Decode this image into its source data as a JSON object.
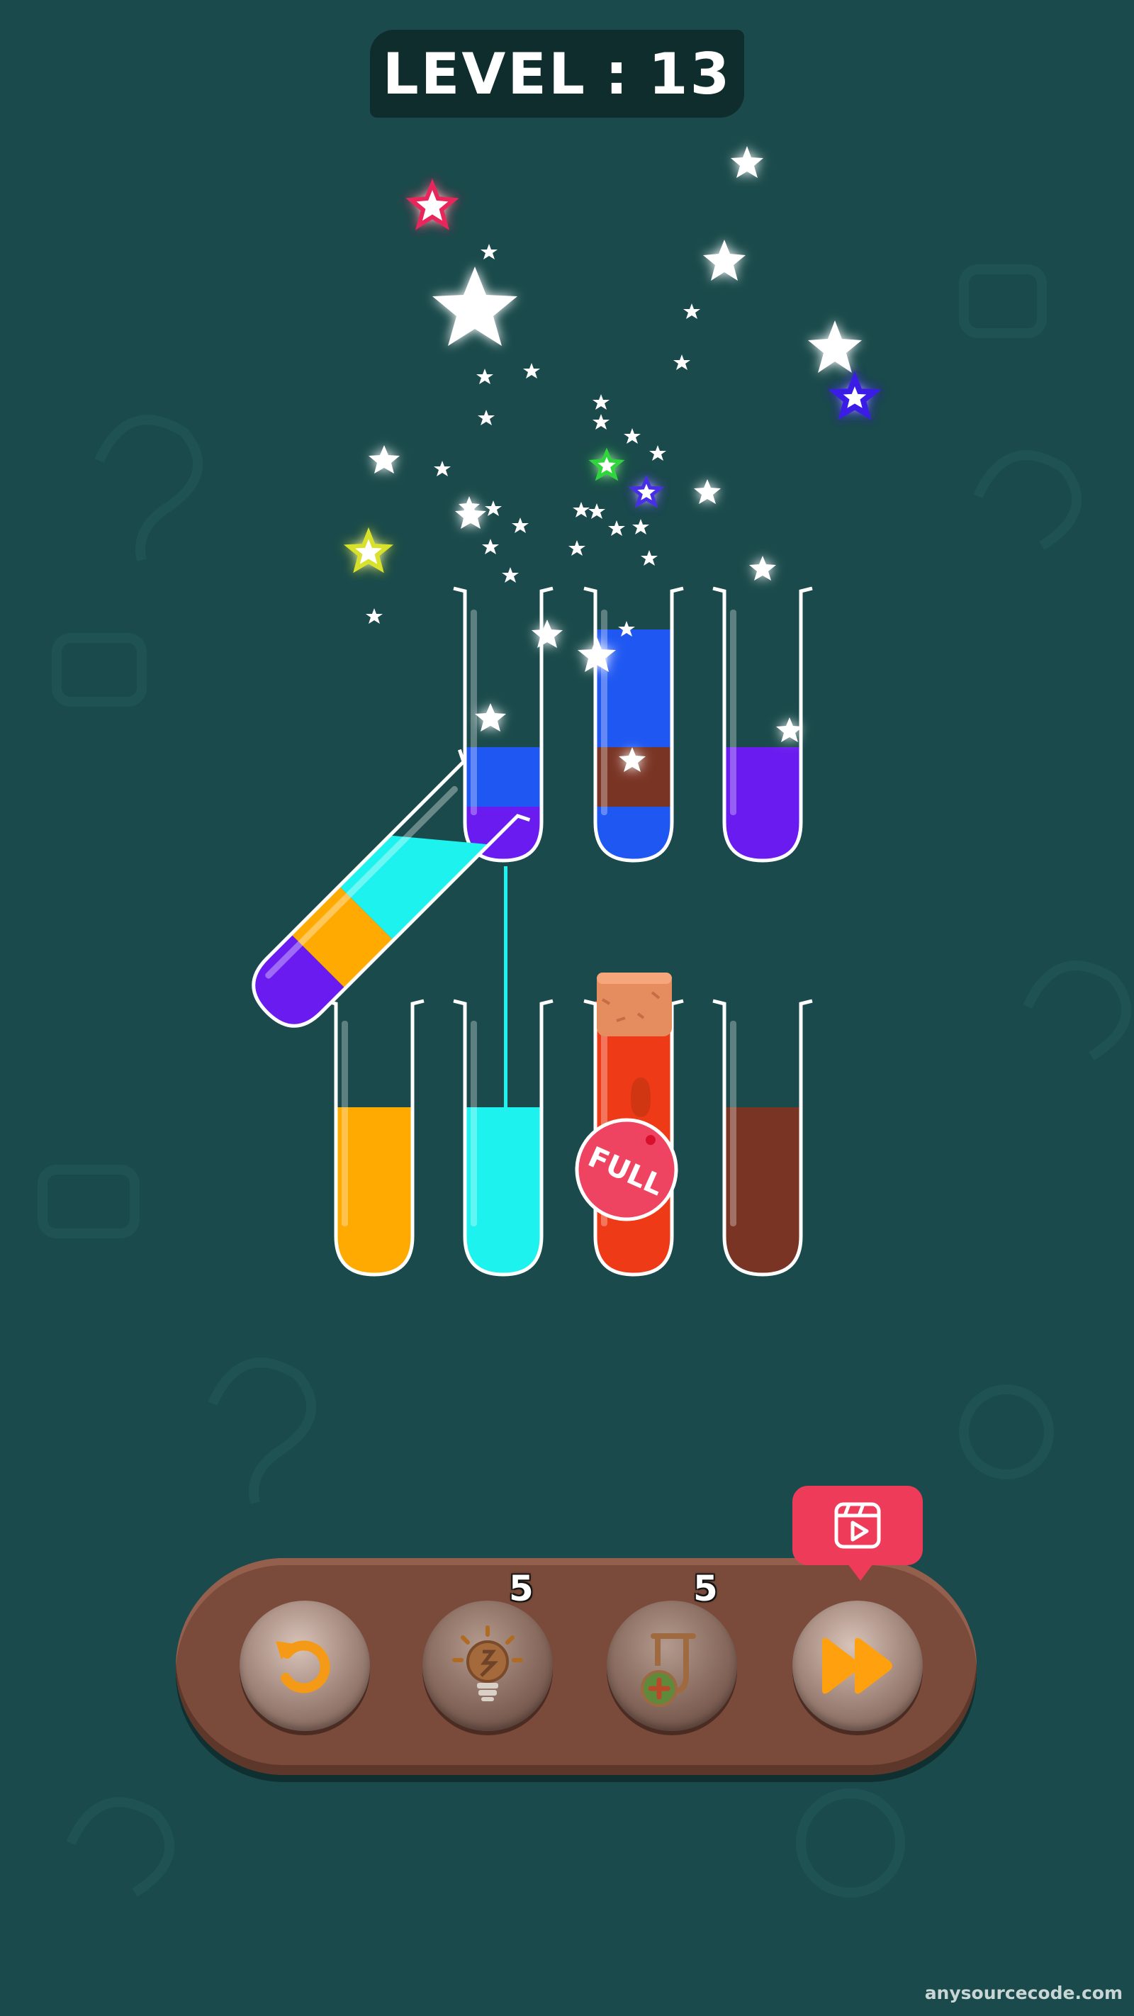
{
  "header": {
    "level_label": "LEVEL",
    "separator": ":",
    "level_number": "13"
  },
  "colors": {
    "background": "#1a4a4b",
    "blue": "#1f57f2",
    "purple": "#6a1cf0",
    "brown": "#7a3424",
    "orange": "#ffaa00",
    "cyan": "#1ef2ef",
    "red": "#ee3a16",
    "cork": "#e58d5f",
    "full_badge": "#ef4461"
  },
  "tubes": [
    {
      "name": "tube-1",
      "layers": [
        "purple",
        "blue"
      ]
    },
    {
      "name": "tube-2",
      "layers": [
        "blue",
        "brown",
        "blue"
      ]
    },
    {
      "name": "tube-3",
      "layers": [
        "purple"
      ]
    },
    {
      "name": "tube-4",
      "layers": [
        "orange"
      ]
    },
    {
      "name": "tube-5",
      "layers": [
        "cyan"
      ]
    },
    {
      "name": "tube-6",
      "layers": [
        "red"
      ],
      "sealed": true,
      "badge": "FULL"
    },
    {
      "name": "tube-7",
      "layers": [
        "brown"
      ]
    },
    {
      "name": "tube-pouring",
      "layers": [
        "purple",
        "orange",
        "cyan"
      ]
    }
  ],
  "toolbar": {
    "undo": {
      "icon": "undo-icon"
    },
    "hint": {
      "icon": "lightbulb-icon",
      "count": "5"
    },
    "add_tube": {
      "icon": "add-tube-icon",
      "count": "5"
    },
    "skip": {
      "icon": "fast-forward-icon",
      "video_icon": "video-icon"
    }
  },
  "watermark": "anysourcecode.com"
}
